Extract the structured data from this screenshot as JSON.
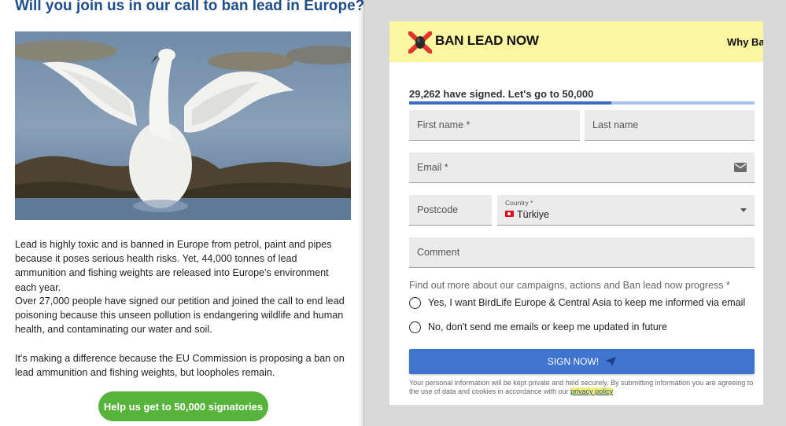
{
  "article": {
    "headline": "Will you join us in our call to ban lead in Europe?",
    "paragraphs": [
      "Lead is highly toxic and is banned in Europe from petrol, paint and pipes because it poses serious health risks. Yet, 44,000 tonnes of lead ammunition and fishing weights are released into Europe's environment each year.",
      "Over 27,000 people have signed our petition and joined the call to end lead poisoning because this unseen pollution is endangering wildlife and human health, and contaminating our water and soil.",
      "It's making a difference because the EU Commission is proposing a ban on lead ammunition and fishing weights, but loopholes remain."
    ],
    "cta_label": "Help us get to 50,000 signatories"
  },
  "embed": {
    "logo_text": "BAN LEAD NOW",
    "nav_item": "Why Ba",
    "progress": {
      "text": "29,262 have signed. Let's go to 50,000",
      "fraction": 0.585
    },
    "form": {
      "first_name": "First name *",
      "last_name": "Last name",
      "email": "Email *",
      "postcode": "Postcode",
      "country_label": "Country *",
      "country_value": "Türkiye",
      "comment": "Comment",
      "consent_question": "Find out more about our campaigns, actions and Ban lead now progress *",
      "option_yes": "Yes, I want BirdLife Europe & Central Asia to keep me informed via email",
      "option_no": "No, don't send me emails or keep me updated in future",
      "submit": "SIGN NOW!",
      "privacy_text": "Your personal information will be kept private and held securely. By submitting information you are agreeing to the use of data and cookies in accordance with our",
      "privacy_link": "privacy policy"
    }
  },
  "colors": {
    "headline": "#1f4e8a",
    "cta": "#58b33c",
    "header_bg": "#fbf6a2",
    "logo_red": "#e3352b",
    "progress_fill": "#3b6dc7",
    "submit": "#3f74cf"
  },
  "icons": {
    "logo": "crossed-bullet-logo-icon",
    "email": "envelope-icon",
    "country_flag": "turkey-flag-icon",
    "dropdown": "caret-down-icon",
    "submit": "paper-plane-icon"
  }
}
